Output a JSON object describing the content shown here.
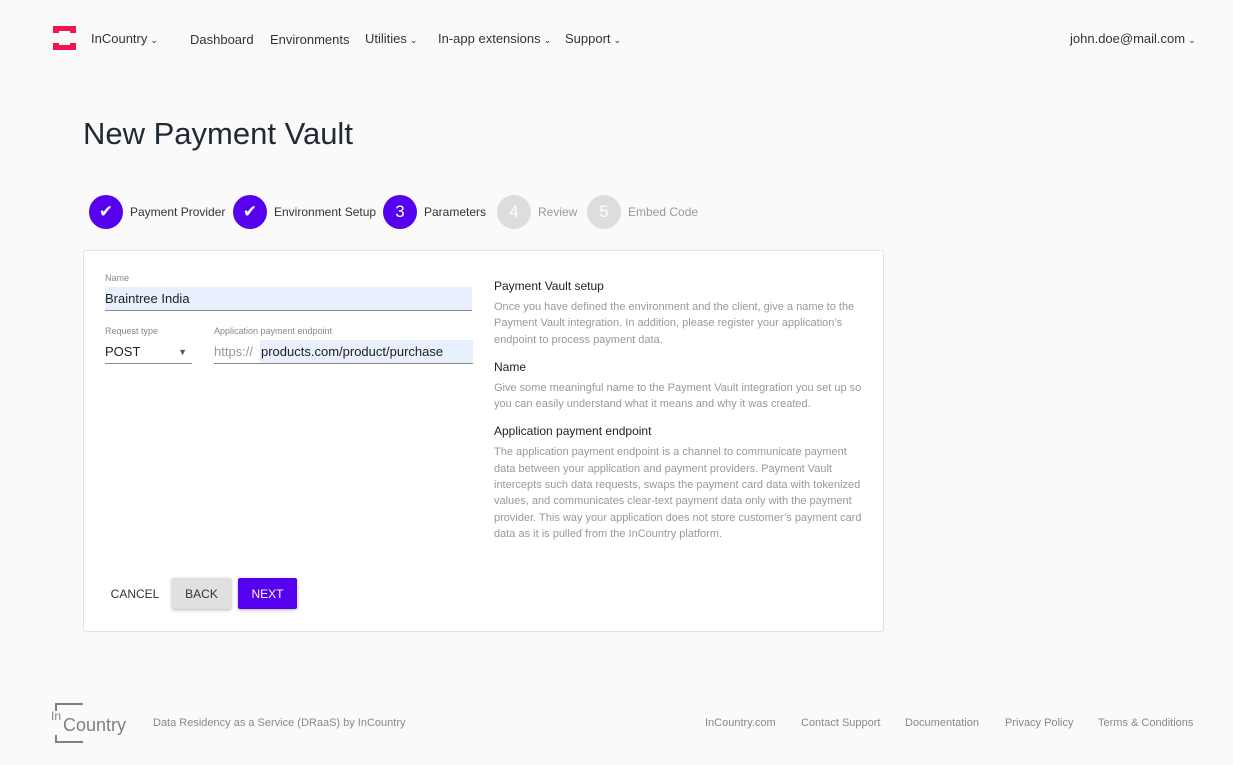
{
  "nav": {
    "brand": "InCountry",
    "items": [
      "Dashboard",
      "Environments",
      "Utilities",
      "In-app extensions",
      "Support"
    ],
    "user": "john.doe@mail.com"
  },
  "page": {
    "title": "New Payment Vault"
  },
  "steps": [
    {
      "label": "Payment Provider",
      "state": "done"
    },
    {
      "label": "Environment Setup",
      "state": "done"
    },
    {
      "num": "3",
      "label": "Parameters",
      "state": "active"
    },
    {
      "num": "4",
      "label": "Review",
      "state": "pending"
    },
    {
      "num": "5",
      "label": "Embed Code",
      "state": "pending"
    }
  ],
  "form": {
    "name_label": "Name",
    "name_value": "Braintree India",
    "request_label": "Request type",
    "request_value": "POST",
    "endpoint_label": "Application payment endpoint",
    "endpoint_prefix": "https://",
    "endpoint_value": "products.com/product/purchase"
  },
  "help": [
    {
      "title": "Payment Vault setup",
      "text": "Once you have defined the environment and the client, give a name to the Payment Vault integration. In addition, please register your application’s endpoint to process payment data."
    },
    {
      "title": "Name",
      "text": "Give some meaningful name to the Payment Vault integration you set up so you can easily understand what it means and why it was created."
    },
    {
      "title": "Application payment endpoint",
      "text": "The application payment endpoint is a channel to communicate payment data between your application and payment providers. Payment Vault intercepts such data requests, swaps the payment card data with tokenized values, and communicates clear-text payment data only with the payment provider. This way your application does not store customer’s payment card data as it is pulled from the InCountry platform."
    }
  ],
  "buttons": {
    "cancel": "CANCEL",
    "back": "BACK",
    "next": "NEXT"
  },
  "footer": {
    "logo_text": "InCountry",
    "tagline": "Data Residency as a Service (DRaaS) by InCountry",
    "links": [
      "InCountry.com",
      "Contact Support",
      "Documentation",
      "Privacy Policy",
      "Terms & Conditions"
    ]
  },
  "colors": {
    "accent": "#5500ee",
    "logo": "#f0144f"
  }
}
